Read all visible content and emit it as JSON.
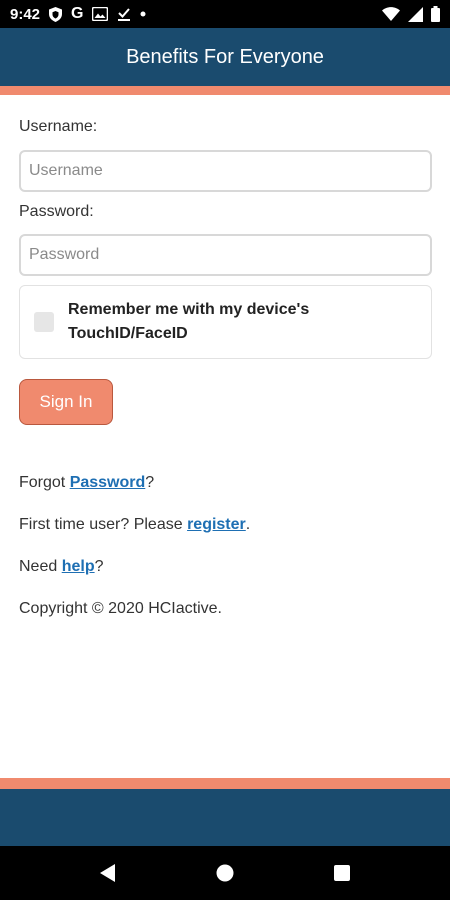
{
  "status_bar": {
    "time": "9:42",
    "icons": [
      "shield-icon",
      "google-g-icon",
      "image-icon",
      "download-done-icon",
      "dot-icon",
      "wifi-icon",
      "signal-icon",
      "battery-icon"
    ],
    "g_letter": "G"
  },
  "app_bar": {
    "title": "Benefits For Everyone"
  },
  "colors": {
    "primary": "#1a4b6e",
    "accent": "#f08a6e",
    "link": "#1e6fb3"
  },
  "form": {
    "username_label": "Username:",
    "username_placeholder": "Username",
    "username_value": "",
    "password_label": "Password:",
    "password_placeholder": "Password",
    "password_value": "",
    "remember_label": "Remember me with my device's TouchID/FaceID",
    "remember_checked": false,
    "signin_label": "Sign In"
  },
  "links": {
    "forgot_prefix": "Forgot ",
    "forgot_link": "Password",
    "forgot_suffix": "?",
    "first_prefix": "First time user? Please ",
    "first_link": "register",
    "first_suffix": ".",
    "help_prefix": "Need ",
    "help_link": "help",
    "help_suffix": "?"
  },
  "copyright": "Copyright © 2020 HCIactive.",
  "nav_bar": {
    "icons": [
      "back-icon",
      "home-icon",
      "recents-icon"
    ]
  }
}
